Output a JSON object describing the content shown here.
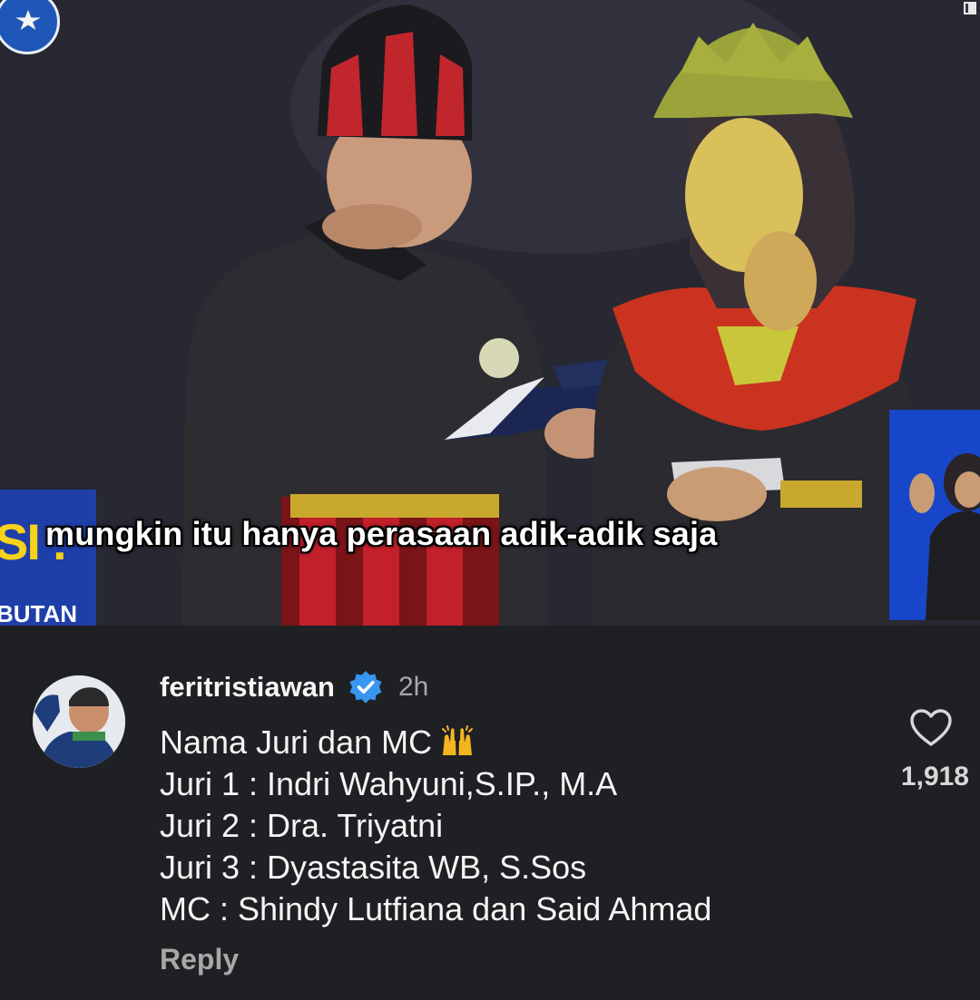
{
  "video": {
    "subtitle": "mungkin itu hanya perasaan adik-adik saja",
    "banner_letters": "SI :",
    "banner_text": "BUTAN"
  },
  "comment": {
    "username": "feritristiawan",
    "verified": true,
    "time": "2h",
    "lines": [
      "Nama Juri dan MC",
      "Juri 1 : Indri Wahyuni,S.IP., M.A",
      "Juri 2 : Dra. Triyatni",
      "Juri 3 : Dyastasita WB, S.Sos",
      "MC : Shindy Lutfiana dan Said Ahmad"
    ],
    "first_line_emoji": "raising-hands",
    "reply_label": "Reply",
    "like_count": "1,918"
  },
  "colors": {
    "background": "#1f2024",
    "verified_badge": "#3797f0",
    "text_primary": "#f5f5f5",
    "text_secondary": "#a8a8a8"
  },
  "icons": [
    "verified-badge-icon",
    "heart-outline-icon",
    "raising-hands-emoji"
  ]
}
